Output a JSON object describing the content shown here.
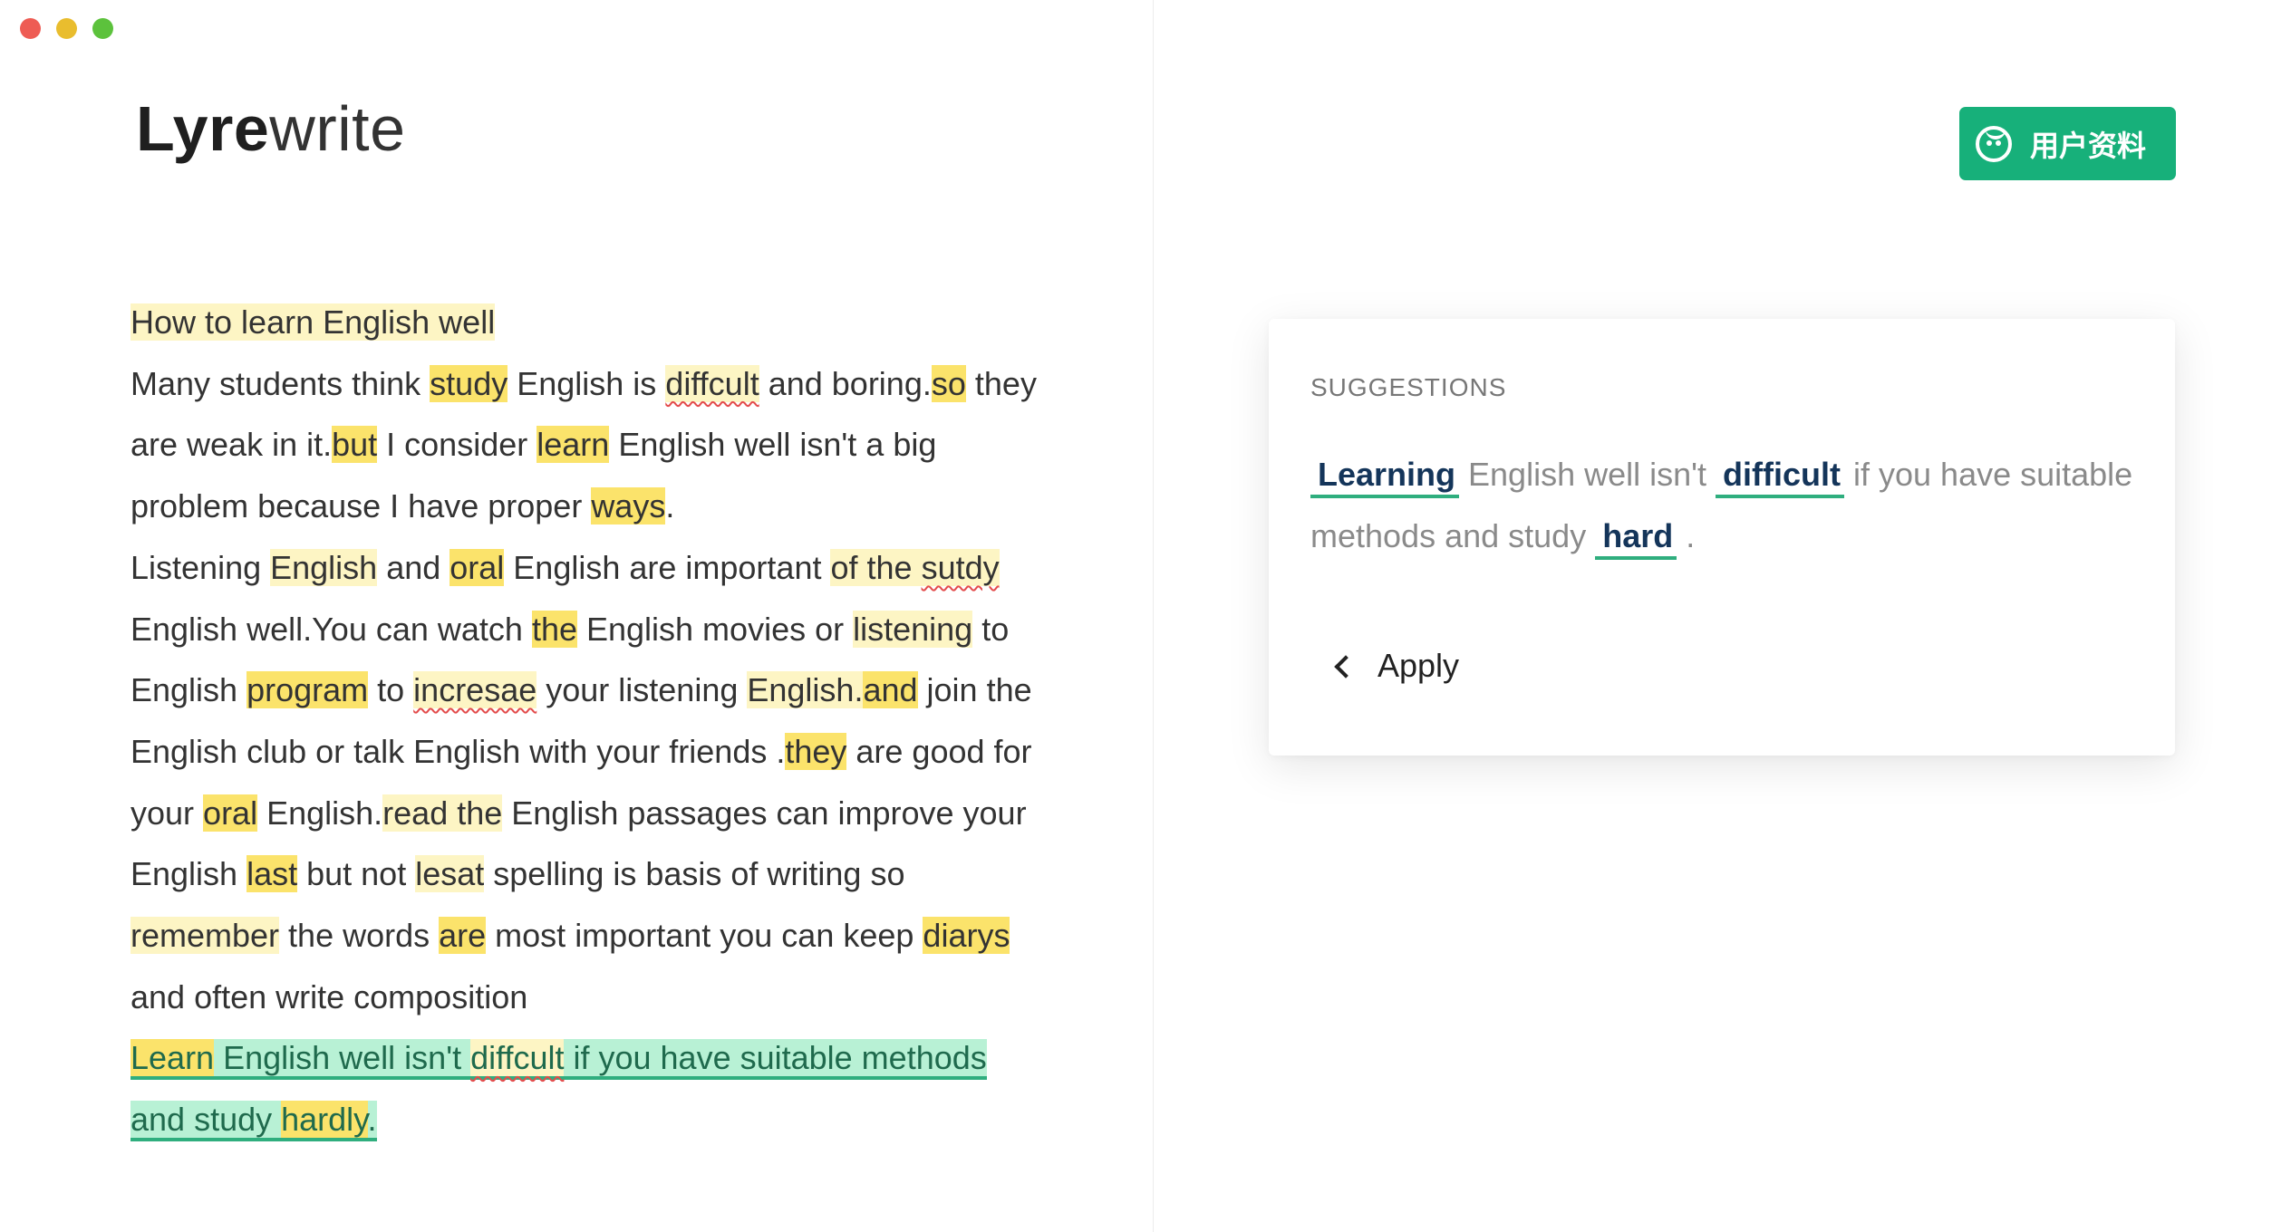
{
  "app": {
    "logo_bold": "Lyre",
    "logo_light": "write"
  },
  "header": {
    "profile_button_label": "用户资料",
    "profile_icon": "face-icon"
  },
  "colors": {
    "accent": "#17b07a",
    "highlight_light": "#fdf5c4",
    "highlight_strong": "#fbe36b",
    "suggestion_bg": "#b8f1d5",
    "spelling_error": "#e34b4b"
  },
  "editor": {
    "title": "How to learn English well",
    "p1": {
      "t1": "Many students think ",
      "w_study": "study",
      "t2": " English is ",
      "w_diffcult": "diffcult",
      "t3": " and boring.",
      "w_so": "so",
      "t4": " they are weak in it.",
      "w_but": "but",
      "t5": " I consider ",
      "w_learn": "learn",
      "t6": " English well isn't a big problem because I have proper ",
      "w_ways": "ways",
      "t7": "."
    },
    "p2": {
      "t1": "Listening ",
      "w_english": "English",
      "t2": " and ",
      "w_oral": "oral",
      "t3": " English are important ",
      "w_ofthe": "of the ",
      "w_sutdy": "sutdy",
      "t4": " English well.You can watch ",
      "w_the": "the",
      "t5": " English movies or ",
      "w_listening": "listening",
      "t6": " to English ",
      "w_program": "program",
      "t7": " to ",
      "w_incresae": "incresae",
      "t8": " your listening ",
      "w_english2": "English.",
      "w_and": "and",
      "t9": " join the English club or talk English with your friends .",
      "w_they": "they",
      "t10": " are good for your ",
      "w_oral2": "oral",
      "t11": " English.",
      "w_readthe": "read the",
      "t12": " English passages can improve your English ",
      "w_last": "last",
      "t13": " but not ",
      "w_lesat": "lesat",
      "t14": " spelling is basis of writing so ",
      "w_remember": "remember",
      "t15": " the words ",
      "w_are": "are",
      "t16": " most important you can keep ",
      "w_diarys": "diarys",
      "t17": " and often write composition"
    },
    "p3": {
      "w_learn": "Learn",
      "t1": " English well isn't ",
      "w_diffcult": "diffcult",
      "t2": " if you have suitable methods and study ",
      "w_hardly": "hardly",
      "t3": "."
    }
  },
  "suggestions": {
    "heading": "SUGGESTIONS",
    "r1": "Learning",
    "s1": " English well isn't ",
    "r2": "difficult",
    "s2": " if you have suitable methods and study ",
    "r3": "hard",
    "s3": " .",
    "apply_label": "Apply",
    "apply_icon": "chevron-left-icon"
  }
}
